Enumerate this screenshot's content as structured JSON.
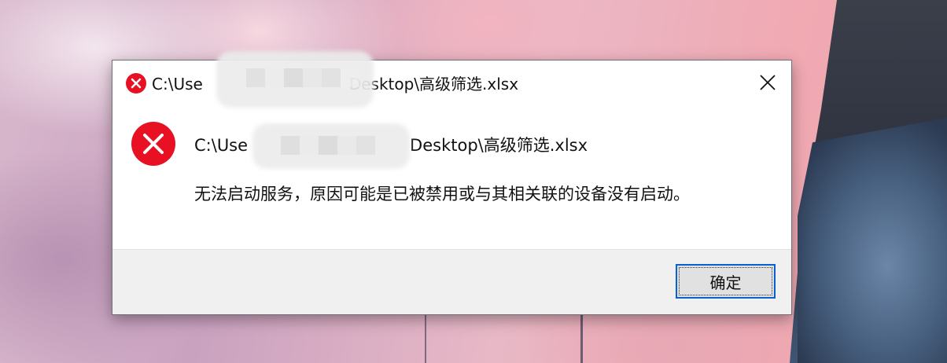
{
  "dialog": {
    "title": "C:\\Users\\████████\\Desktop\\高级筛选.xlsx",
    "title_visible_prefix": "C:\\Use",
    "title_visible_suffix": "Desktop\\高级筛选.xlsx",
    "path": "C:\\Users\\████████\\Desktop\\高级筛选.xlsx",
    "path_visible_prefix": "C:\\Use",
    "path_visible_suffix": "Desktop\\高级筛选.xlsx",
    "message": "无法启动服务，原因可能是已被禁用或与其相关联的设备没有启动。",
    "ok_label": "确定",
    "icons": {
      "title": "error-icon",
      "main": "error-icon",
      "close": "close-icon"
    },
    "colors": {
      "error_red": "#e81123",
      "focus_border": "#0a5fd1"
    }
  }
}
